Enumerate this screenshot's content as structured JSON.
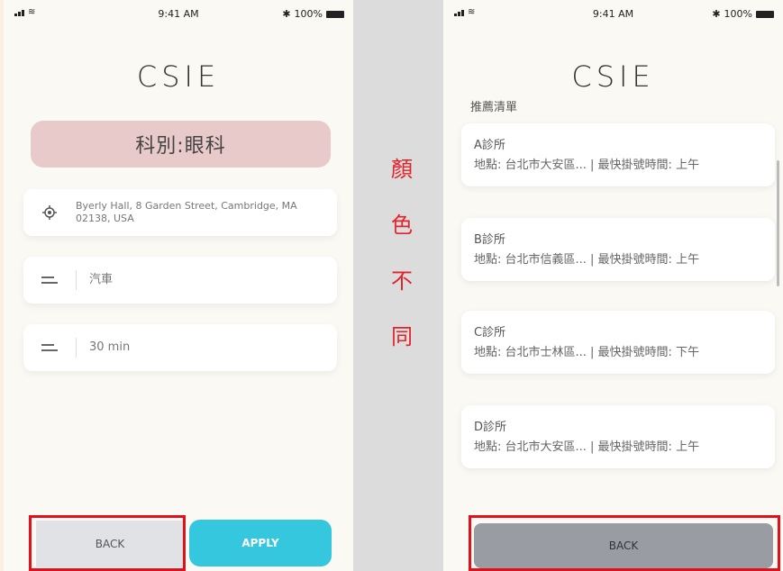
{
  "status_bar": {
    "time": "9:41 AM",
    "battery": "100%",
    "bluetooth": "✱"
  },
  "app_title": "CSIE",
  "left_screen": {
    "department": "科別:眼科",
    "address": "Byerly Hall, 8 Garden Street, Cambridge, MA 02138, USA",
    "transport": "汽車",
    "duration": "30 min",
    "back_label": "BACK",
    "apply_label": "APPLY"
  },
  "annotation": {
    "chars": [
      "顏",
      "色",
      "不",
      "同"
    ],
    "color": "#e0242c"
  },
  "right_screen": {
    "list_header": "推薦清單",
    "clinics": [
      {
        "name": "A診所",
        "detail": "地點: 台北市大安區... | 最快掛號時間: 上午"
      },
      {
        "name": "B診所",
        "detail": "地點: 台北市信義區... | 最快掛號時間: 上午"
      },
      {
        "name": "C診所",
        "detail": "地點: 台北市士林區... | 最快掛號時間: 下午"
      },
      {
        "name": "D診所",
        "detail": "地點: 台北市大安區... | 最快掛號時間: 上午"
      }
    ],
    "back_label": "BACK"
  },
  "colors": {
    "accent": "#35c7de",
    "highlight": "#e0111b",
    "pill": "#e8caca",
    "back_right": "#9a9ca3",
    "back_left": "#e1e2e6"
  }
}
